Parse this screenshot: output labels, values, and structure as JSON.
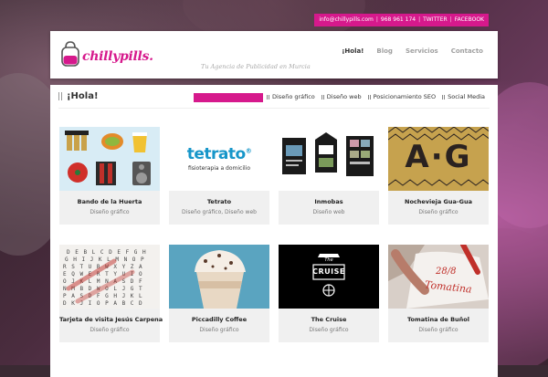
{
  "contact": {
    "email": "info@chillypills.com",
    "phone": "968 961 174",
    "twitter": "TWITTER",
    "facebook": "FACEBOOK",
    "sep": "|"
  },
  "header": {
    "logo_text": "chillypills.",
    "tagline": "Tu Agencia de Publicidad en Murcia",
    "nav": [
      "¡Hola!",
      "Blog",
      "Servicios",
      "Contacto"
    ]
  },
  "page": {
    "title": "¡Hola!",
    "filters": [
      "Diseño gráfico",
      "Diseño web",
      "Posicionamiento SEO",
      "Social Media"
    ]
  },
  "portfolio": [
    {
      "title": "Bando de la Huerta",
      "category": "Diseño gráfico"
    },
    {
      "title": "Tetrato",
      "category": "Diseño gráfico, Diseño web",
      "thumb_brand": "tetrato",
      "thumb_reg": "®",
      "thumb_sub": "fisioterapia a domicilio"
    },
    {
      "title": "Inmobas",
      "category": "Diseño web"
    },
    {
      "title": "Nochevieja Gua-Gua",
      "category": "Diseño gráfico",
      "thumb_text": "A·G"
    },
    {
      "title": "Tarjeta de visita Jesús Carpena",
      "category": "Diseño gráfico"
    },
    {
      "title": "Piccadilly Coffee",
      "category": "Diseño gráfico"
    },
    {
      "title": "The Cruise",
      "category": "Diseño gráfico",
      "thumb_text": "CRUISE",
      "thumb_the": "The"
    },
    {
      "title": "Tomatina de Buñol",
      "category": "Diseño gráfico",
      "thumb_date": "28/8",
      "thumb_word": "Tomatina"
    }
  ],
  "colors": {
    "brand": "#d6198c",
    "accent_blue": "#1696c9"
  }
}
